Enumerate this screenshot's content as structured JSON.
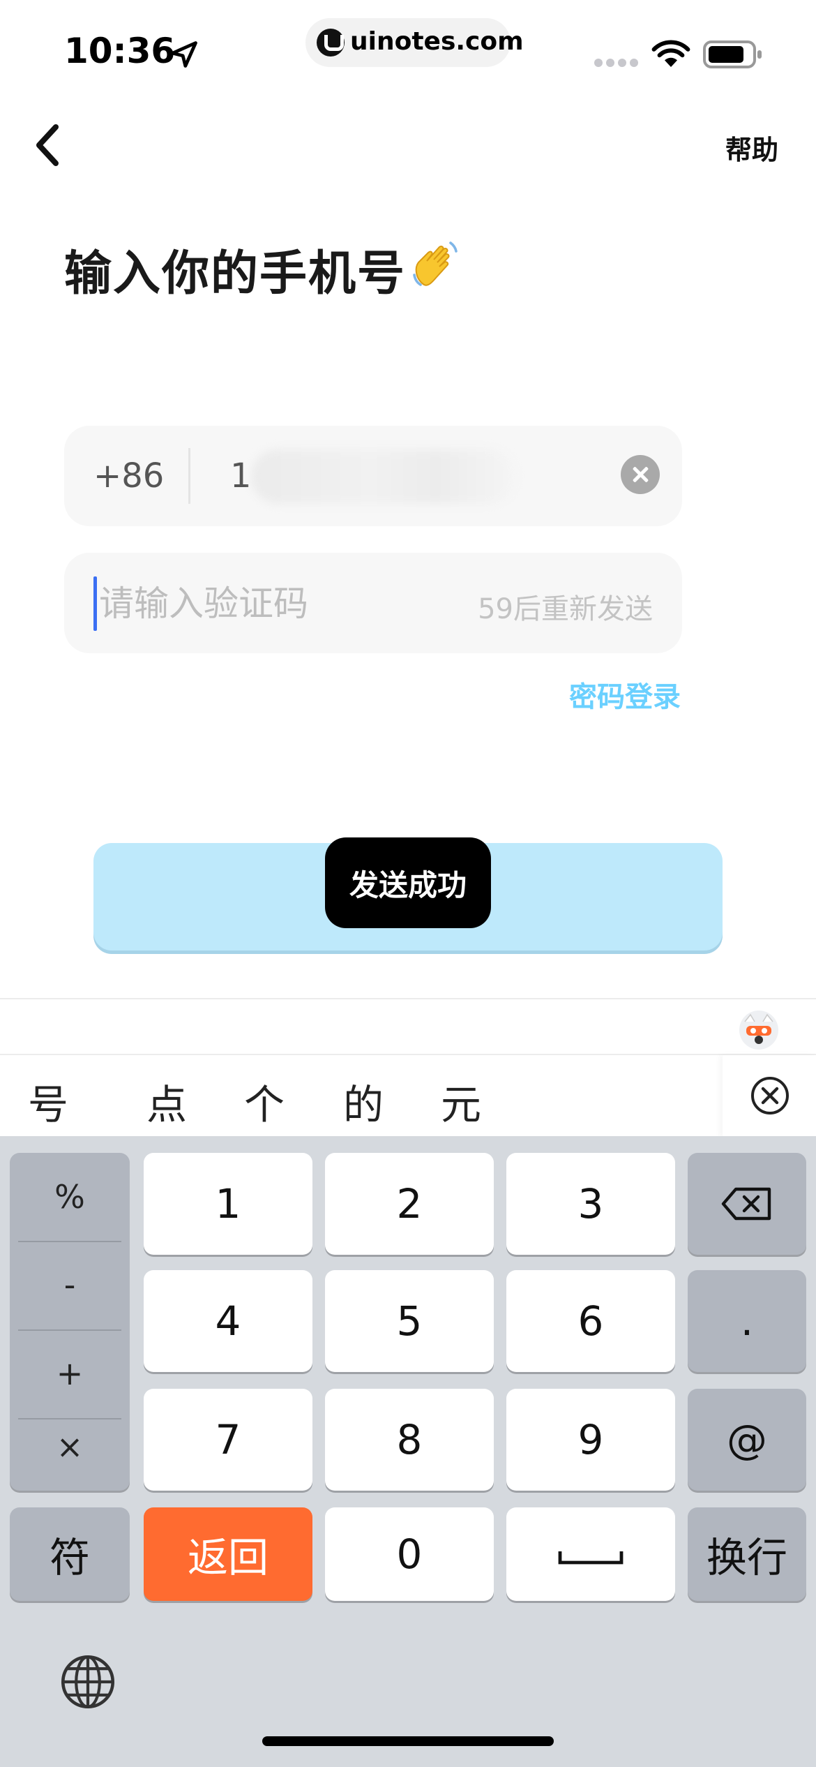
{
  "status_bar": {
    "time": "10:36",
    "url": "uinotes.com",
    "location_icon": "location-arrow-icon",
    "wifi_icon": "wifi-icon",
    "battery_icon": "battery-icon"
  },
  "nav": {
    "back_icon": "chevron-left-icon",
    "help_label": "帮助"
  },
  "page": {
    "title": "输入你的手机号",
    "title_emoji": "waving-hand-icon"
  },
  "phone_field": {
    "country_code": "+86",
    "number_visible": "1",
    "clear_icon": "clear-circle-icon"
  },
  "code_field": {
    "placeholder": "请输入验证码",
    "value": "",
    "resend_label": "59后重新发送"
  },
  "password_login_label": "密码登录",
  "submit_button_label": "",
  "toast_text": "发送成功",
  "candidates": [
    "号",
    "点",
    "个",
    "的",
    "元"
  ],
  "keyboard": {
    "symbols": [
      "%",
      "-",
      "+",
      "×"
    ],
    "digits": [
      "1",
      "2",
      "3",
      "4",
      "5",
      "6",
      "7",
      "8",
      "9"
    ],
    "zero": "0",
    "dot": ".",
    "at": "@",
    "symbol_toggle": "符",
    "back_label": "返回",
    "newline_label": "换行",
    "space_label": "␣",
    "delete_icon": "backspace-icon",
    "globe_icon": "globe-icon",
    "accent_color": "#ff6b30"
  },
  "colors": {
    "link": "#6ad0ff",
    "submit_bg": "#bee9fb",
    "caret": "#3b6ff3"
  }
}
